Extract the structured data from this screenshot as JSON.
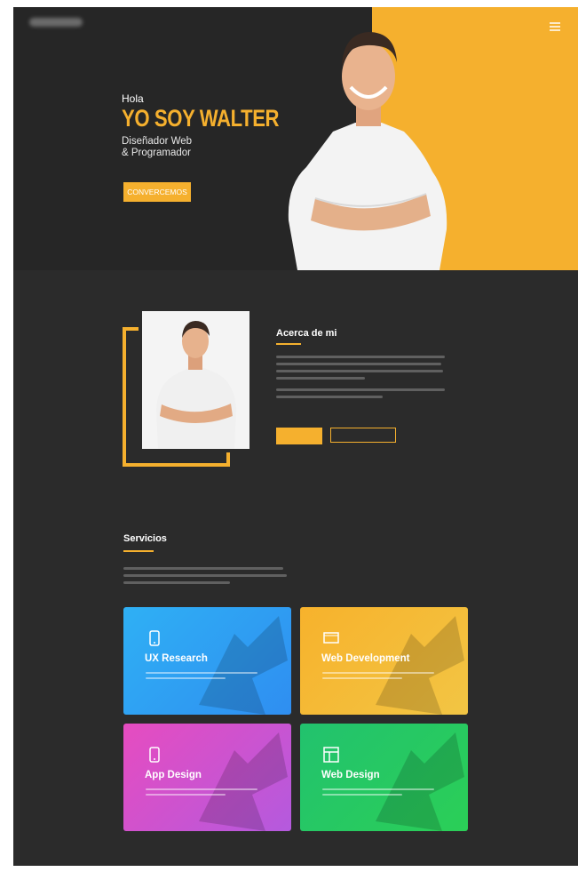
{
  "hero": {
    "greeting": "Hola",
    "name": "YO SOY WALTER",
    "role": "Diseñador Web\n& Programador",
    "cta_label": "CONVERCEMOS"
  },
  "about": {
    "title": "Acerca de mi"
  },
  "services": {
    "title": "Servicios",
    "cards": [
      {
        "title": "UX Research",
        "icon": "mobile-icon",
        "color": "#2fa4f4"
      },
      {
        "title": "Web Development",
        "icon": "monitor-icon",
        "color": "#f5b42e"
      },
      {
        "title": "App Design",
        "icon": "mobile-icon",
        "color": "#d650cb"
      },
      {
        "title": "Web Design",
        "icon": "layout-icon",
        "color": "#27c766"
      }
    ]
  },
  "colors": {
    "accent": "#f5b02e",
    "background": "#2b2b2b"
  }
}
